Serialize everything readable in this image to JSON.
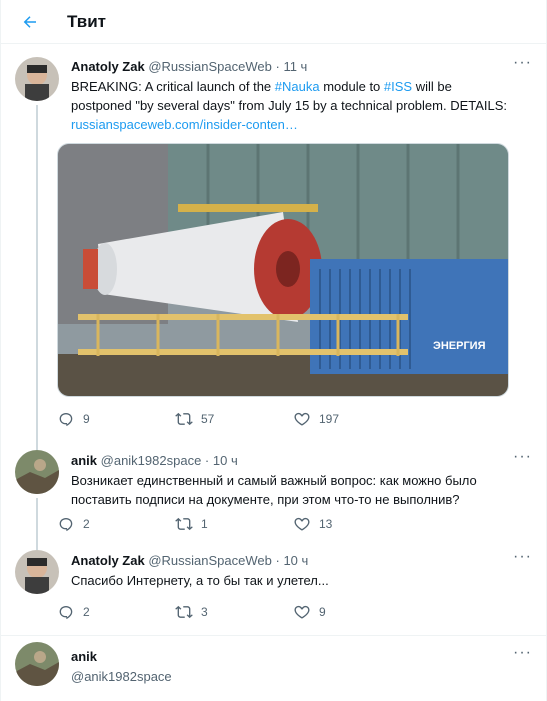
{
  "header": {
    "title": "Твит"
  },
  "tweets": [
    {
      "name": "Anatoly Zak",
      "handle": "@RussianSpaceWeb",
      "dot": "·",
      "time": "11 ч",
      "text_lines": [
        [
          "BREAKING: A critical launch of the ",
          "#Nauka",
          " module to ",
          "#ISS",
          " will be"
        ],
        "postponed \"by several days\" from July 15 by a technical problem. DETAILS:",
        "russianspaceweb.com/insider-conten…"
      ],
      "replies": "9",
      "retweets": "57",
      "likes": "197",
      "media_text": "ЭНЕРГИЯ"
    },
    {
      "name": "anik",
      "handle": "@anik1982space",
      "dot": "·",
      "time": "10 ч",
      "text_lines": [
        "Возникает единственный и самый важный вопрос: как можно было",
        "поставить подписи на документе, при этом что-то не выполнив?"
      ],
      "replies": "2",
      "retweets": "1",
      "likes": "13"
    },
    {
      "name": "Anatoly Zak",
      "handle": "@RussianSpaceWeb",
      "dot": "·",
      "time": "10 ч",
      "text_lines": [
        "Спасибо Интернету, а то бы так и улетел..."
      ],
      "replies": "2",
      "retweets": "3",
      "likes": "9"
    },
    {
      "name": "anik",
      "handle": "@anik1982space"
    }
  ],
  "more": "···",
  "colors": {
    "accent": "#1d9bf0",
    "secondary": "#536471",
    "border": "#eff3f4"
  },
  "icons": [
    "arrow-left-icon",
    "reply-icon",
    "retweet-icon",
    "like-icon",
    "more-icon"
  ]
}
